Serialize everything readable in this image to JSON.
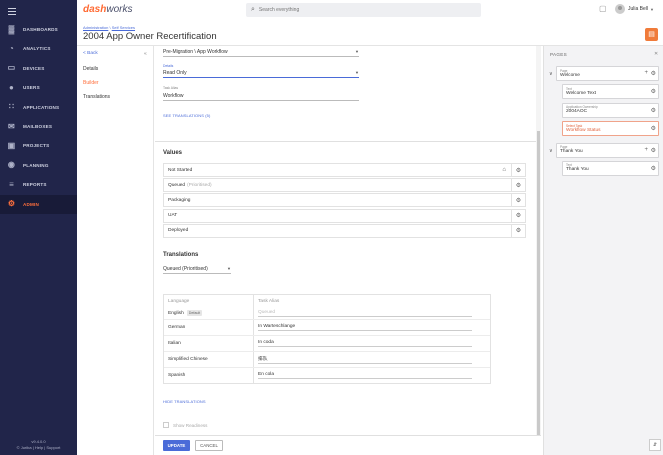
{
  "sidebar": {
    "items": [
      {
        "label": "DASHBOARDS",
        "icon": "bar-chart-icon"
      },
      {
        "label": "ANALYTICS",
        "icon": "analytics-icon"
      },
      {
        "label": "DEVICES",
        "icon": "laptop-icon"
      },
      {
        "label": "USERS",
        "icon": "user-icon"
      },
      {
        "label": "APPLICATIONS",
        "icon": "apps-grid-icon"
      },
      {
        "label": "MAILBOXES",
        "icon": "mail-icon"
      },
      {
        "label": "PROJECTS",
        "icon": "projects-icon"
      },
      {
        "label": "PLANNING",
        "icon": "compass-icon"
      },
      {
        "label": "REPORTS",
        "icon": "list-icon"
      },
      {
        "label": "ADMIN",
        "icon": "gear-icon"
      }
    ],
    "active_item": "ADMIN",
    "version": "v9.4.0.0",
    "footer": "© Juriba | Help | Support",
    "active_color": "#ff6f3c",
    "background_color": "#21254a"
  },
  "topbar": {
    "logo_dash": "dash",
    "logo_works": "works",
    "search_placeholder": "Search everything",
    "user_name": "Julia Bell"
  },
  "header": {
    "breadcrumb_1": "Administration",
    "breadcrumb_sep": " \\ ",
    "breadcrumb_2": "Self Services",
    "title": "2004 App Owner Recertification"
  },
  "subnav": {
    "back": "< Back",
    "items": [
      "Details",
      "Builder",
      "Translations"
    ],
    "active": "Builder"
  },
  "form": {
    "workflow_select": "Pre-Migration \\ App Workflow",
    "details_label": "Details",
    "details_value": "Read Only",
    "task_alias_label": "Task Alias",
    "task_alias_value": "Workflow",
    "see_translations": "SEE TRANSLATIONS (5)"
  },
  "values": {
    "title": "Values",
    "rows": [
      {
        "label": "Not Started",
        "tag": ""
      },
      {
        "label": "Queued",
        "tag": "(Prioritised)"
      },
      {
        "label": "Packaging",
        "tag": ""
      },
      {
        "label": "UAT",
        "tag": ""
      },
      {
        "label": "Deployed",
        "tag": ""
      }
    ]
  },
  "translations": {
    "title": "Translations",
    "selected_value": "Queued (Prioritised)",
    "header_language": "Language",
    "header_alias": "Task Alias",
    "default_badge": "Default",
    "rows": [
      {
        "language": "English",
        "alias": "Queued"
      },
      {
        "language": "German",
        "alias": "In Warteschlange"
      },
      {
        "language": "Italian",
        "alias": "In coda"
      },
      {
        "language": "Simplified Chinese",
        "alias": "排队"
      },
      {
        "language": "Spanish",
        "alias": "En cola"
      }
    ],
    "hide_link": "HIDE TRANSLATIONS"
  },
  "show_readiness": "Show Readiness",
  "buttons": {
    "update": "UPDATE",
    "cancel": "CANCEL"
  },
  "pages_panel": {
    "title": "PAGES",
    "pages": [
      {
        "type": "Page",
        "name": "Welcome",
        "children": [
          {
            "type": "Text",
            "value": "Welcome Text",
            "error": false
          },
          {
            "type": "Application Ownership",
            "value": "2004AOC",
            "error": false
          },
          {
            "type": "Select Task",
            "value": "Workflow Status",
            "error": true
          }
        ]
      },
      {
        "type": "Page",
        "name": "Thank You",
        "children": [
          {
            "type": "Text",
            "value": "Thank You",
            "error": false
          }
        ]
      }
    ]
  }
}
